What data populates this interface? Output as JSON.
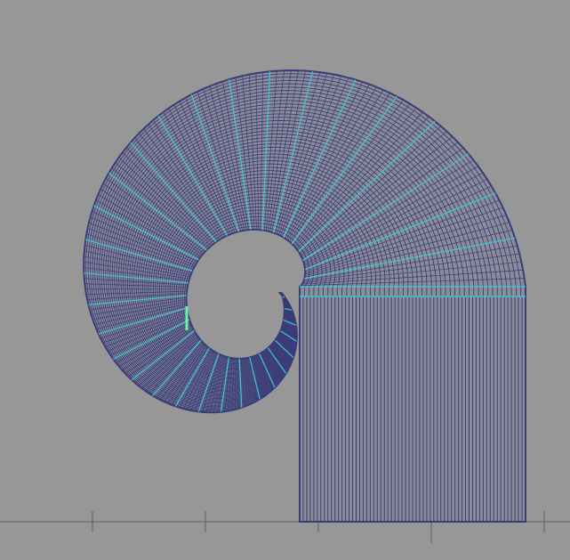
{
  "viewport": {
    "background_color": "#979797",
    "grid_line_color": "#5f5f5f"
  },
  "mesh": {
    "edge_color": "#3b3c78",
    "face_color": "#8a8c98",
    "highlight_edge_color": "#38c9d6",
    "selected_edge_color": "#6cf2a6",
    "straight_section_lines": 64,
    "curved_section_lines": 200,
    "radial_highlight_lines": 32
  }
}
